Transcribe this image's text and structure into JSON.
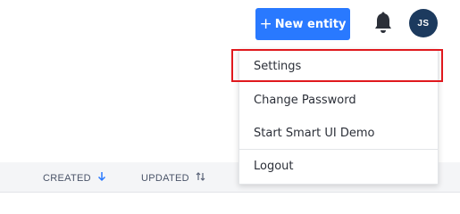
{
  "toolbar": {
    "new_button_label": "New entity",
    "new_button_icon": "plus-icon",
    "notifications_icon": "bell-icon",
    "avatar_initials": "JS",
    "accent_color": "#2979ff",
    "avatar_color": "#1c3a5e"
  },
  "table": {
    "columns": [
      {
        "label": "CREATED",
        "sort_icon": "arrow-down-icon",
        "sort_color": "#2979ff"
      },
      {
        "label": "UPDATED",
        "sort_icon": "sort-updown-icon"
      }
    ]
  },
  "user_menu": {
    "items": [
      {
        "label": "Settings",
        "highlighted": true
      },
      {
        "label": "Change Password"
      },
      {
        "label": "Start Smart UI Demo"
      },
      {
        "label": "Logout"
      }
    ],
    "highlight_color": "#e0191e"
  }
}
